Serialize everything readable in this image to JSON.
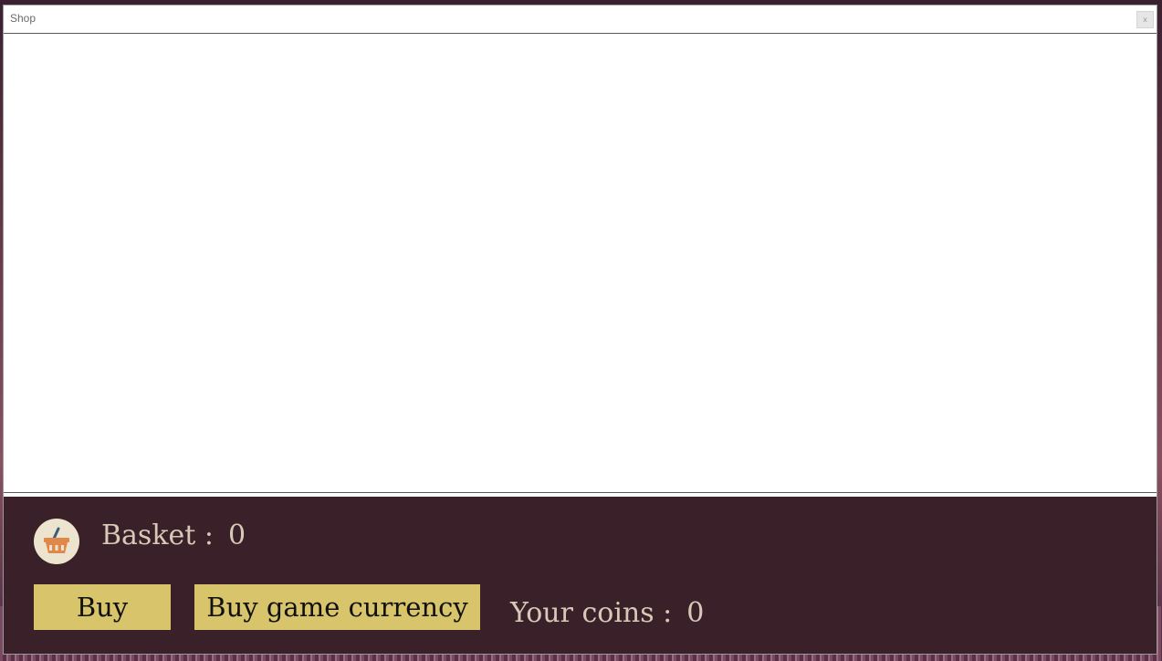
{
  "window": {
    "title": "Shop",
    "close_label": "x"
  },
  "basket": {
    "label": "Basket :",
    "count": "0",
    "icon": "basket-icon"
  },
  "buttons": {
    "buy_label": "Buy",
    "currency_label": "Buy game currency"
  },
  "coins": {
    "label": "Your coins :",
    "value": "0"
  },
  "colors": {
    "panel_background": "#3a2028",
    "button_background": "#d8c46a",
    "label_text": "#d8c8b8",
    "icon_circle": "#ece4cf",
    "basket_orange": "#e0884a"
  }
}
